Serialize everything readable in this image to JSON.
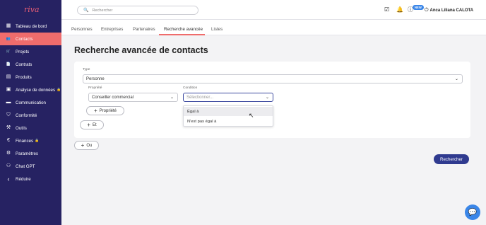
{
  "sidebar": {
    "logo": "riva",
    "items": [
      {
        "label": "Tableau de bord",
        "icon": "dashboard-icon",
        "glyph": "▦"
      },
      {
        "label": "Contacts",
        "icon": "users-icon",
        "glyph": "👥"
      },
      {
        "label": "Projets",
        "icon": "cart-icon",
        "glyph": "🛒"
      },
      {
        "label": "Contrats",
        "icon": "document-icon",
        "glyph": "📄"
      },
      {
        "label": "Produits",
        "icon": "box-icon",
        "glyph": "▤"
      },
      {
        "label": "Analyse de données",
        "icon": "chart-icon",
        "glyph": "▣"
      },
      {
        "label": "Communication",
        "icon": "message-icon",
        "glyph": "▬"
      },
      {
        "label": "Conformité",
        "icon": "shield-icon",
        "glyph": "⛉"
      },
      {
        "label": "Outils",
        "icon": "tools-icon",
        "glyph": "⚒"
      },
      {
        "label": "Finances",
        "icon": "euro-icon",
        "glyph": "€"
      },
      {
        "label": "Paramètres",
        "icon": "gear-icon",
        "glyph": "⚙"
      },
      {
        "label": "Chat GPT",
        "icon": "robot-icon",
        "glyph": "⚇"
      },
      {
        "label": "Réduire",
        "icon": "chevron-left-icon",
        "glyph": "‹"
      }
    ]
  },
  "topbar": {
    "search_placeholder": "Rechercher",
    "badge": "NEW",
    "user_name": "Anca Liliana CALOTA"
  },
  "tabs": [
    "Personnes",
    "Entreprises",
    "Partenaires",
    "Recherche avancée",
    "Listes"
  ],
  "page_title": "Recherche avancée de contacts",
  "form": {
    "type_label": "Type",
    "type_value": "Personne",
    "property_label": "Propriété",
    "property_value": "Conseiller commercial",
    "condition_label": "Condition",
    "condition_placeholder": "Sélectionner...",
    "add_property": "Propriété",
    "and_button": "Et",
    "or_button": "Ou",
    "search_button": "Rechercher"
  },
  "dropdown": {
    "options": [
      "Égal à",
      "N'est pas égal à"
    ]
  },
  "colors": {
    "sidebar": "#262262",
    "active": "#ef6c6c",
    "primary": "#2f3a8f"
  }
}
